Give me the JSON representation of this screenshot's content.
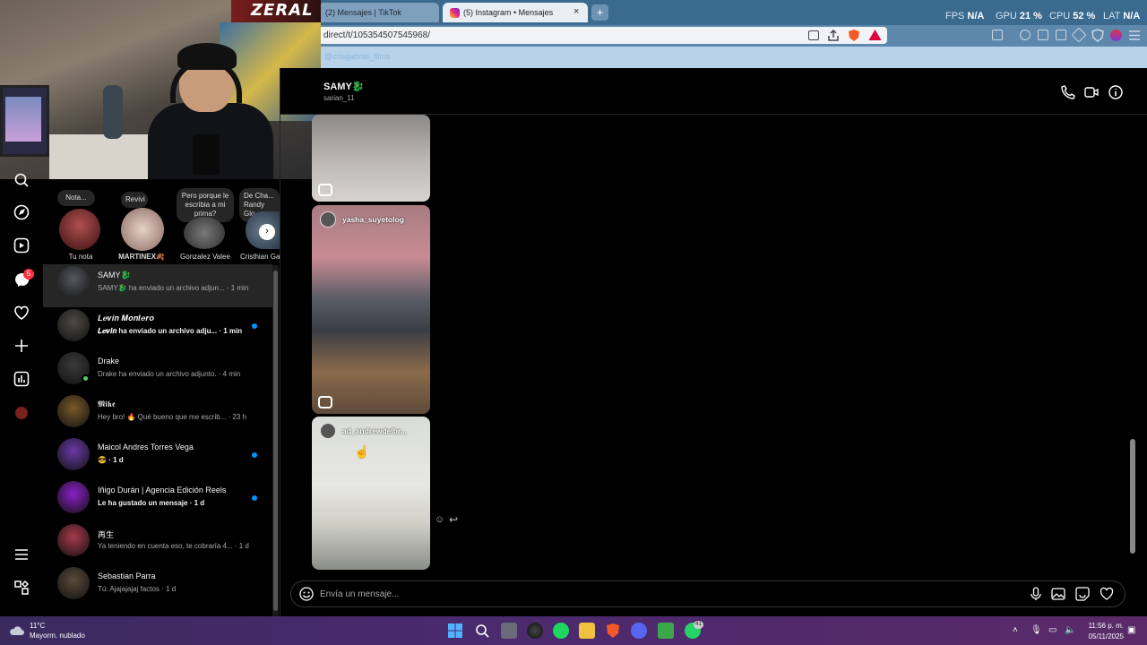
{
  "browser": {
    "tabs": [
      {
        "label": "(2) Mensajes | TikTok"
      },
      {
        "label": "(5) Instagram • Mensajes"
      }
    ],
    "tab_close": "×",
    "new_tab": "+",
    "url": "direct/t/105354507545968/",
    "bookmark": "@crisgabriel_films",
    "hud": {
      "fps_label": "FPS",
      "fps_value": "N/A",
      "gpu_label": "GPU",
      "gpu_value": "21 %",
      "cpu_label": "CPU",
      "cpu_value": "52 %",
      "lat_label": "LAT",
      "lat_value": "N/A"
    }
  },
  "stream_overlay": {
    "brand": "ZERAL"
  },
  "rail": {
    "notification_count": "5"
  },
  "notes": [
    {
      "bubble": "Nota...",
      "name": "Tu nota"
    },
    {
      "bubble": "Revivi",
      "name": "MARTINEX🍂"
    },
    {
      "bubble": "Pero porque le escribia a mi prima?",
      "name": "Gonzalez Valee"
    },
    {
      "bubble": "De Cha... Randy Glo",
      "name": "Cristhian Ga"
    }
  ],
  "conversations": [
    {
      "name": "SAMY🐉",
      "preview": "SAMY🐉 ha enviado un archivo adjun... · 1 min",
      "unread": false,
      "active": true,
      "avatar_color": "#55585e"
    },
    {
      "name": "𝑳𝒆𝒗𝒊𝒏 𝑴𝒐𝒏𝒕𝒆𝒓𝒐",
      "preview": "𝑳𝒆𝒗𝒊𝒏 ha enviado un archivo adju... · 1 min",
      "unread": true,
      "active": false,
      "avatar_color": "#4e4a44"
    },
    {
      "name": "Drake",
      "preview": "Drake ha enviado un archivo adjunto. · 4 min",
      "unread": false,
      "active": false,
      "online": true,
      "avatar_color": "#3a3a3a"
    },
    {
      "name": "𝕸𝖎𝖐𝖊",
      "preview": "Hey bro! 🔥 Qué bueno que me escrib... · 23 h",
      "unread": false,
      "active": false,
      "avatar_color": "#7a5a2a"
    },
    {
      "name": "Maicol Andres Torres Vega",
      "preview": "😎 · 1 d",
      "unread": true,
      "active": false,
      "avatar_color": "#6a3aa8"
    },
    {
      "name": "Iñigo Durán | Agencia Edición Reels",
      "preview": "Le ha gustado un mensaje · 1 d",
      "unread": true,
      "active": false,
      "avatar_color": "#8a20c8"
    },
    {
      "name": "再生",
      "preview": "Ya teniendo en cuenta eso, te cobraría 4... · 1 d",
      "unread": false,
      "active": false,
      "avatar_color": "#a83a4a"
    },
    {
      "name": "Sebastian Parra",
      "preview": "Tú: Ajajajajaj factos · 1 d",
      "unread": false,
      "active": false,
      "avatar_color": "#5a4a3a"
    }
  ],
  "chat": {
    "name": "SAMY🐉",
    "username": "sarian_11",
    "reels": [
      {
        "user": ""
      },
      {
        "user": "yasha_suyetolog"
      },
      {
        "user": "ad_andrewdelbr..."
      }
    ],
    "composer_placeholder": "Envía un mensaje..."
  },
  "taskbar": {
    "temperature": "11°C",
    "condition": "Mayorm. nublado",
    "time": "11:56 p. m.",
    "date": "05/11/2025",
    "whatsapp_count": "41"
  },
  "colors": {
    "accent_blue": "#0095f6",
    "badge_red": "#ff3040",
    "online_green": "#4cd964"
  }
}
